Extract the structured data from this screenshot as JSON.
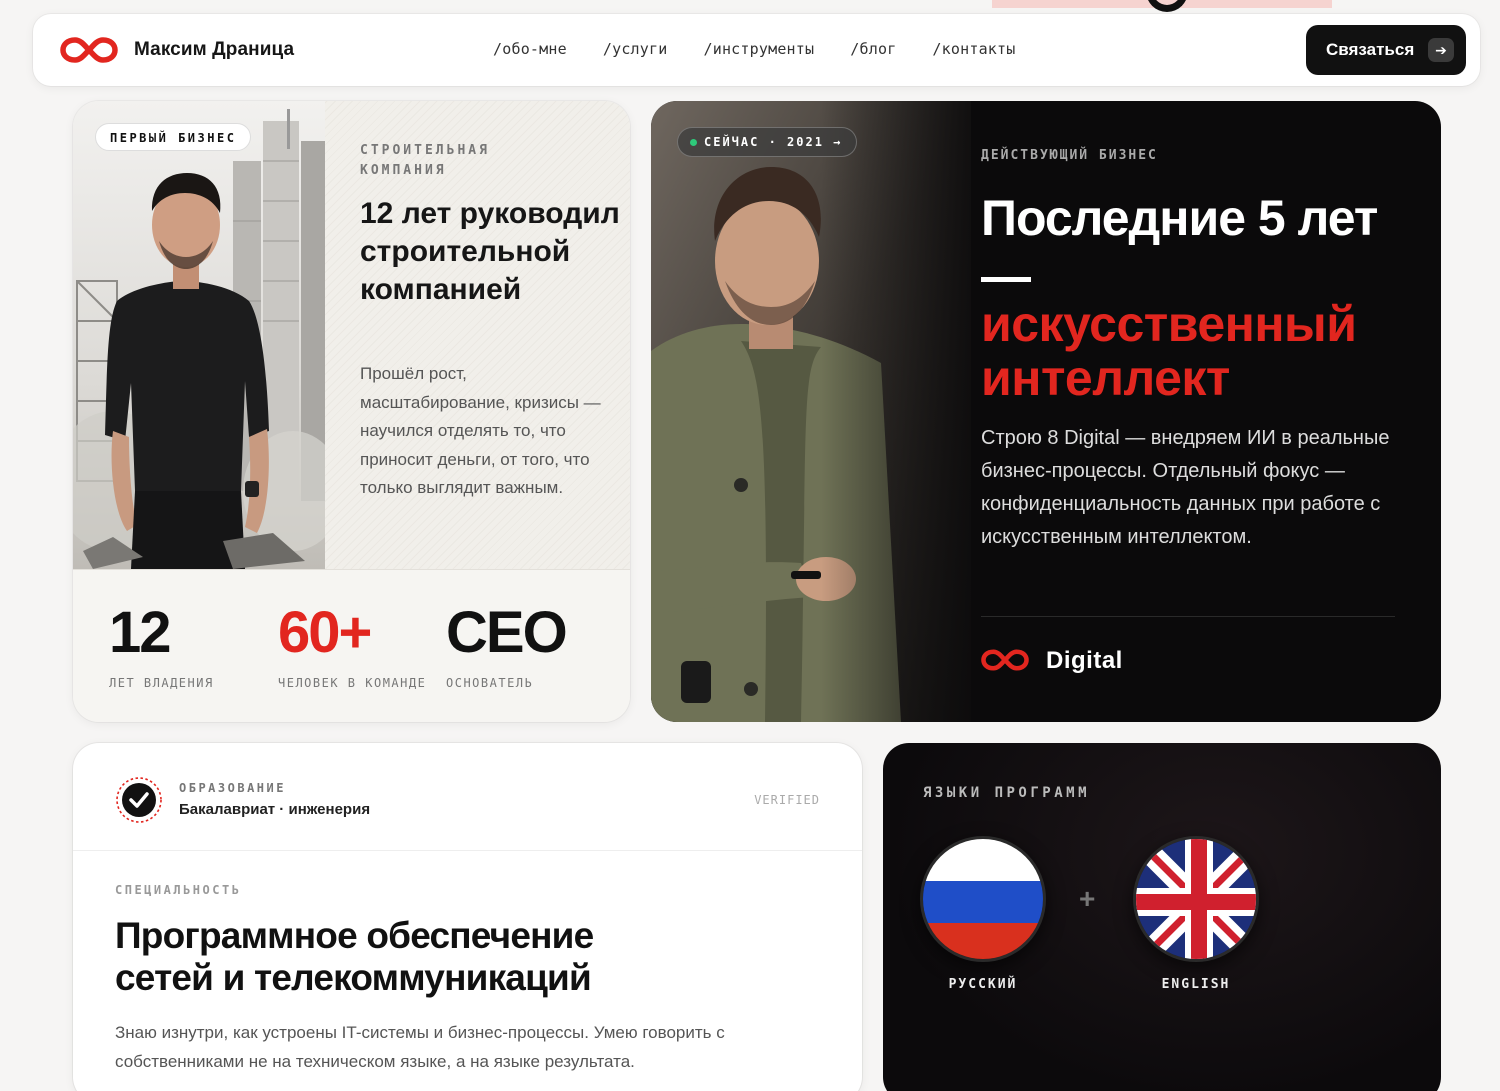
{
  "nav": {
    "brand": "Максим Драница",
    "links": [
      "/обо-мне",
      "/услуги",
      "/инструменты",
      "/блог",
      "/контакты"
    ],
    "cta_label": "Связаться",
    "cta_icon": "arrow-right-icon"
  },
  "first_business": {
    "badge": "ПЕРВЫЙ БИЗНЕС",
    "eyebrow": "СТРОИТЕЛЬНАЯ КОМПАНИЯ",
    "title": "12 лет руководил строительной компанией",
    "text": "Прошёл рост, масштабирование, кризисы — научился отделять то, что приносит деньги, от того, что только выглядит важным.",
    "stats": [
      {
        "value": "12",
        "label": "ЛЕТ ВЛАДЕНИЯ"
      },
      {
        "value": "60+",
        "label": "ЧЕЛОВЕК В КОМАНДЕ"
      },
      {
        "value": "CEO",
        "label": "ОСНОВАТЕЛЬ"
      }
    ]
  },
  "current_business": {
    "badge": "СЕЙЧАС · 2021 →",
    "eyebrow": "ДЕЙСТВУЮЩИЙ БИЗНЕС",
    "title": "Последние 5 лет —",
    "title_red": "искусственный интеллект",
    "text": "Строю 8 Digital — внедряем ИИ в реальные бизнес-процессы. Отдельный фокус — конфиденциальность данных при работе с искусственным интеллектом.",
    "brand": "Digital"
  },
  "education": {
    "label": "ОБРАЗОВАНИЕ",
    "value": "Бакалавриат · инженерия",
    "verified": "VERIFIED",
    "spec_label": "СПЕЦИАЛЬНОСТЬ",
    "spec_title": "Программное обеспечение сетей и телекоммуникаций",
    "spec_text": "Знаю изнутри, как устроены IT-системы и бизнес-процессы. Умею говорить с собственниками не на техническом языке, а на языке результата."
  },
  "languages": {
    "label": "ЯЗЫКИ ПРОГРАММ",
    "items": [
      {
        "name": "РУССКИЙ",
        "icon": "russia-flag-icon"
      },
      {
        "name": "ENGLISH",
        "icon": "uk-flag-icon"
      }
    ]
  },
  "colors": {
    "accent": "#e2261f",
    "dark": "#0b0a0b",
    "page": "#f6f5f4"
  }
}
